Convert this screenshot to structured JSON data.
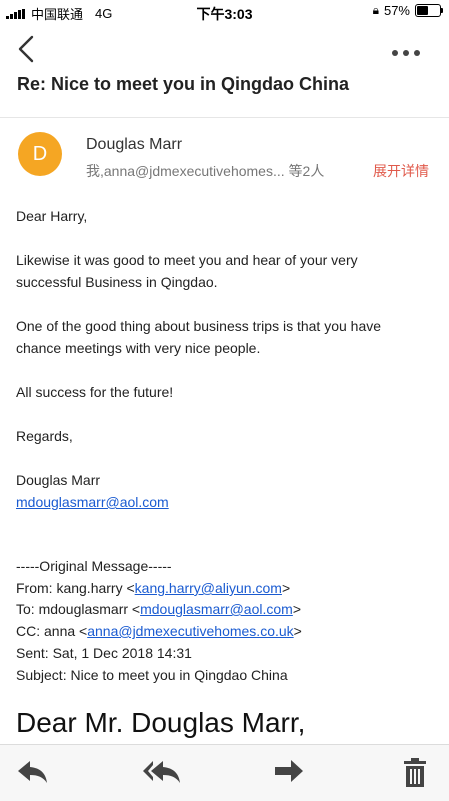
{
  "status": {
    "carrier": "中国联通",
    "network": "4G",
    "time": "下午3:03",
    "battery_text": "57%",
    "battery_level": 0.57
  },
  "header": {
    "subject": "Re: Nice to meet you in Qingdao China"
  },
  "sender": {
    "avatar_letter": "D",
    "avatar_color": "#f5a623",
    "name": "Douglas Marr",
    "recipients": "我,anna@jdmexecutivehomes... 等2人",
    "expand_label": "展开详情"
  },
  "body": {
    "greeting": "Dear Harry,",
    "para1": "Likewise it was good to meet you and hear of your very successful Business in Qingdao.",
    "para2": "One of the good thing about business trips is that you have chance meetings with very nice people.",
    "para3": "All success for the future!",
    "closing": "Regards,",
    "signature_name": "Douglas Marr",
    "signature_email": "mdouglasmarr@aol.com"
  },
  "original": {
    "divider": "-----Original Message-----",
    "from_label": "From: kang.harry <",
    "from_email": "kang.harry@aliyun.com",
    "to_label": "To: mdouglasmarr <",
    "to_email": "mdouglasmarr@aol.com",
    "cc_label": "CC: anna <",
    "cc_email": "anna@jdmexecutivehomes.co.uk",
    "close_bracket": ">",
    "sent": "Sent: Sat, 1 Dec 2018 14:31",
    "subject": "Subject: Nice to meet you in Qingdao China",
    "quoted_greeting": "Dear Mr. Douglas Marr,"
  },
  "toolbar": {
    "icons": [
      "reply-icon",
      "reply-all-icon",
      "forward-icon",
      "trash-icon"
    ]
  },
  "colors": {
    "accent_link": "#1a5bd1",
    "expand_red": "#e05a4b"
  }
}
